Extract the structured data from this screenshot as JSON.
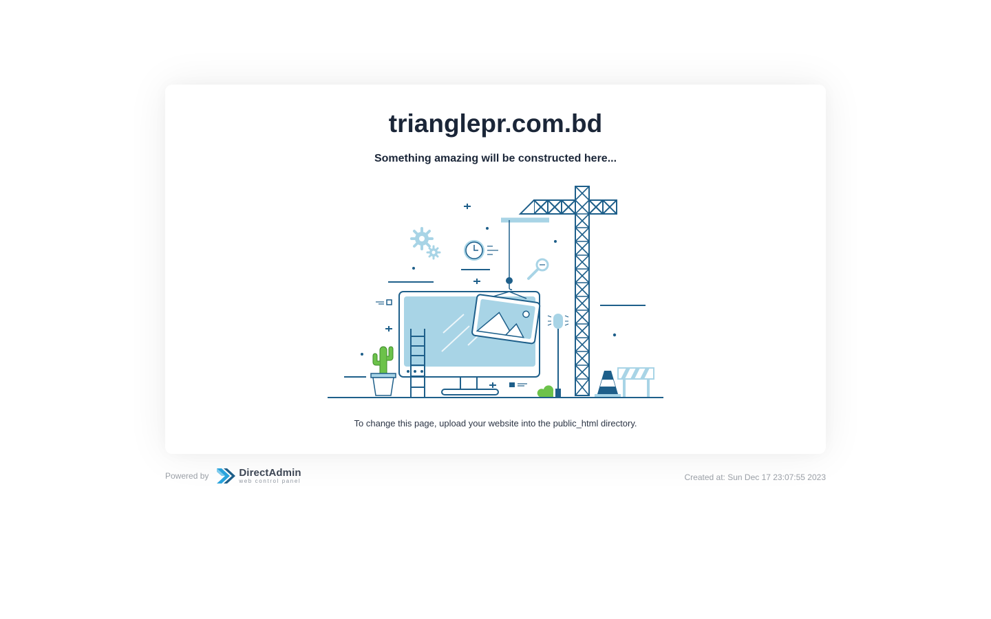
{
  "card": {
    "domain": "trianglepr.com.bd",
    "subtitle": "Something amazing will be constructed here...",
    "instructions": "To change this page, upload your website into the public_html directory."
  },
  "footer": {
    "powered_by": "Powered by",
    "brand_name": "DirectAdmin",
    "brand_tagline": "web control panel",
    "created_at": "Created at: Sun Dec 17 23:07:55 2023"
  },
  "colors": {
    "dark_blue": "#1e5f8a",
    "light_blue": "#a8d4e6",
    "green": "#6cc24a",
    "brand_blue": "#29a3dc"
  },
  "icons": [
    "construction-illustration",
    "crane-icon",
    "monitor-icon",
    "gear-icon",
    "clock-icon",
    "magnifier-icon",
    "cactus-icon",
    "ladder-icon",
    "traffic-cone-icon",
    "barrier-icon",
    "directadmin-logo"
  ]
}
